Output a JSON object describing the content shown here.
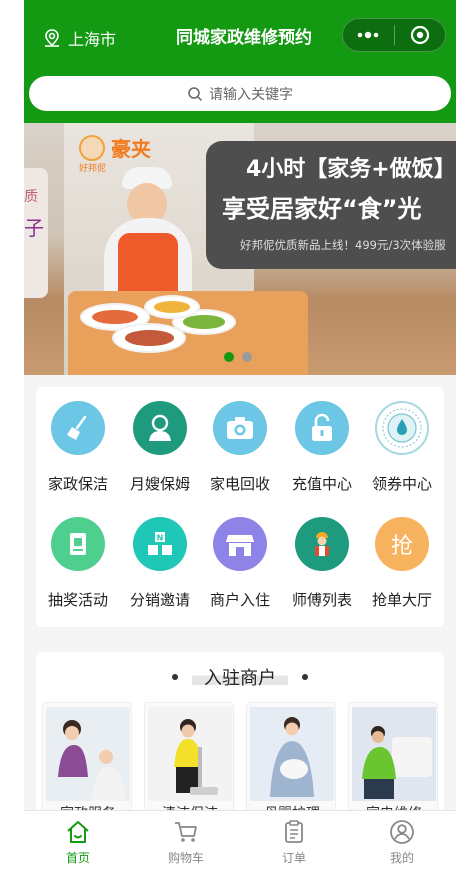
{
  "header": {
    "location": "上海市",
    "title": "同城家政维修预约",
    "capsule": {
      "more": "menu-dots-icon",
      "close": "target-circle-icon"
    }
  },
  "search": {
    "placeholder": "请输入关键字"
  },
  "banner": {
    "left_peek_text_1": "质",
    "left_peek_text_2": "子",
    "brand_name": "豪夹",
    "brand_small": "好邦伲",
    "headline_1": "4小时【家务+做饭】",
    "headline_2": "享受居家好“食”光",
    "subline": "好邦伲优质新品上线！499元/3次体验服",
    "active_slide": 1,
    "slide_count": 2
  },
  "services": [
    {
      "label": "家政保洁",
      "icon": "broom-icon",
      "color": "#6cc6e6"
    },
    {
      "label": "月嫂保姆",
      "icon": "nanny-icon",
      "color": "#1e9a7f"
    },
    {
      "label": "家电回收",
      "icon": "camera-icon",
      "color": "#6cc6e6"
    },
    {
      "label": "充值中心",
      "icon": "unlock-icon",
      "color": "#6cc6e6"
    },
    {
      "label": "领券中心",
      "icon": "coupon-drop-icon",
      "color": "#ffffff"
    },
    {
      "label": "抽奖活动",
      "icon": "lottery-bag-icon",
      "color": "#4fcf8e"
    },
    {
      "label": "分销邀请",
      "icon": "invite-blocks-icon",
      "color": "#1fc7b7"
    },
    {
      "label": "商户入住",
      "icon": "storefront-icon",
      "color": "#8e84e8"
    },
    {
      "label": "师傅列表",
      "icon": "worker-icon",
      "color": "#1e9a7f"
    },
    {
      "label": "抢单大厅",
      "icon": "grab-order-icon",
      "color": "#f7b25e",
      "glyph": "抢"
    }
  ],
  "merchants": {
    "title": "入驻商户",
    "items": [
      {
        "name": "家政服务"
      },
      {
        "name": "清洁保洁"
      },
      {
        "name": "母婴护理"
      },
      {
        "name": "家电维修"
      }
    ]
  },
  "tabbar": {
    "items": [
      {
        "label": "首页",
        "icon": "home-icon",
        "active": true
      },
      {
        "label": "购物车",
        "icon": "cart-icon",
        "active": false
      },
      {
        "label": "订单",
        "icon": "order-list-icon",
        "active": false
      },
      {
        "label": "我的",
        "icon": "user-icon",
        "active": false
      }
    ]
  },
  "colors": {
    "brand_green": "#139a12",
    "page_bg": "#f5f5f5"
  }
}
